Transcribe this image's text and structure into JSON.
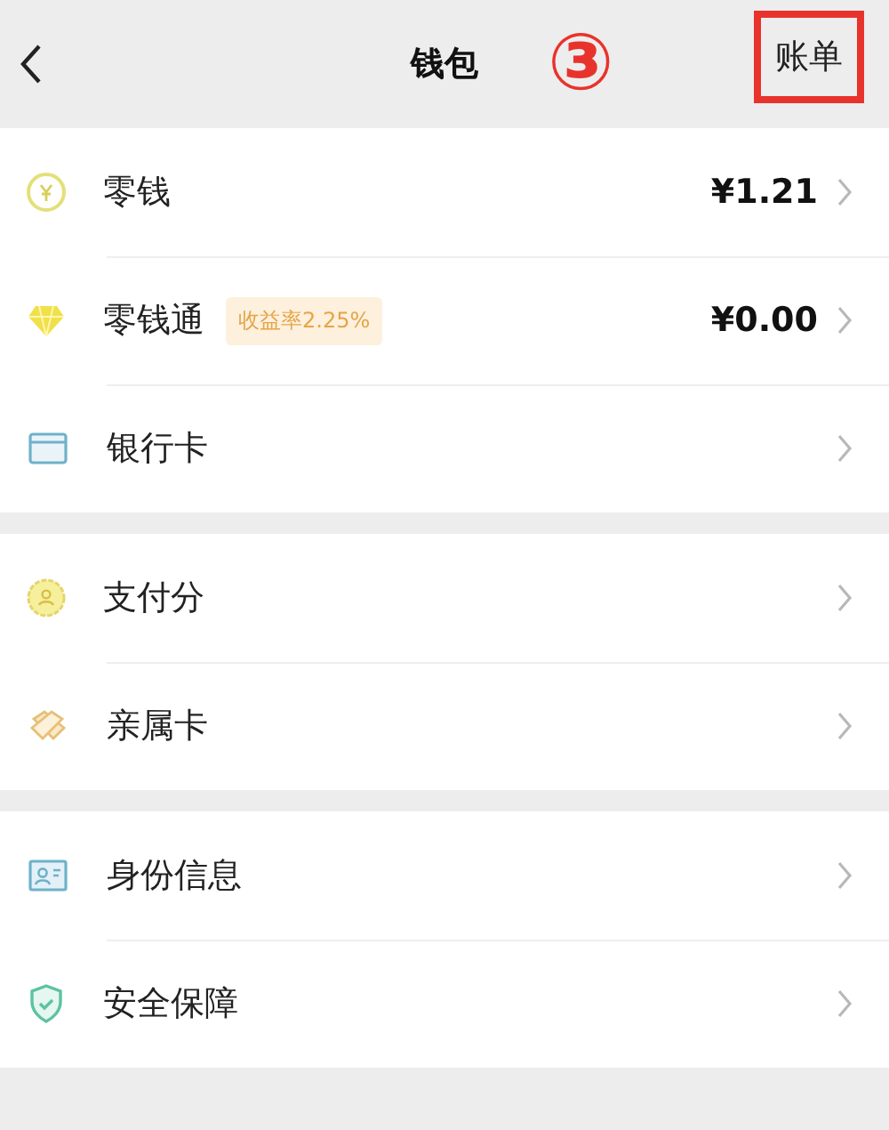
{
  "header": {
    "title": "钱包",
    "action": "账单",
    "step_marker": "③",
    "action_highlighted": true
  },
  "groups": [
    {
      "items": [
        {
          "kind": "coin",
          "label": "零钱",
          "value": "¥1.21"
        },
        {
          "kind": "diamond",
          "label": "零钱通",
          "tag": "收益率2.25%",
          "value": "¥0.00"
        },
        {
          "kind": "card",
          "label": "银行卡"
        }
      ]
    },
    {
      "items": [
        {
          "kind": "badge",
          "label": "支付分"
        },
        {
          "kind": "hearts",
          "label": "亲属卡"
        }
      ]
    },
    {
      "items": [
        {
          "kind": "id",
          "label": "身份信息"
        },
        {
          "kind": "shield",
          "label": "安全保障"
        }
      ]
    }
  ]
}
